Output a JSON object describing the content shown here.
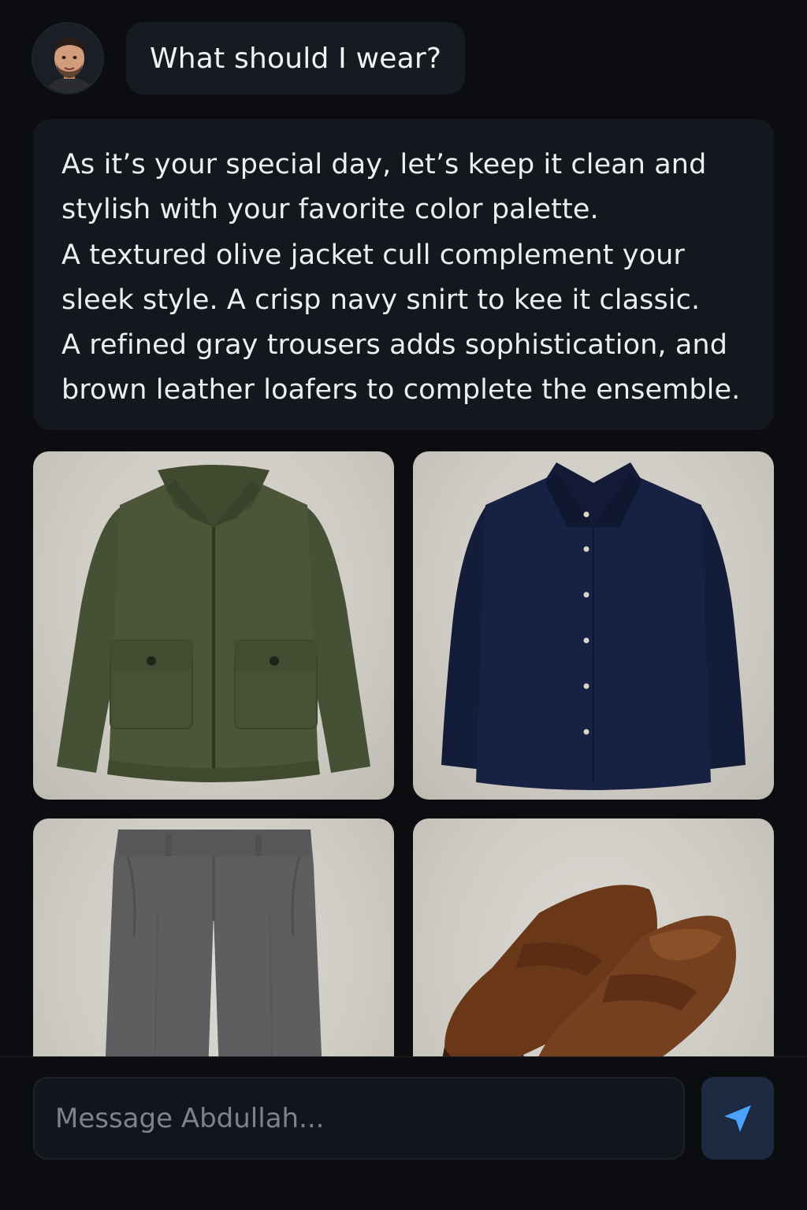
{
  "chat": {
    "user": {
      "avatar_icon": "user-portrait-avatar",
      "message": "What should I wear?"
    },
    "assistant": {
      "lines": [
        "As it’s your special day, let’s keep it clean and",
        "stylish with your favorite color palette.",
        "A textured olive jacket cull complement your",
        "sleek style. A crisp navy snirt to kee it classic.",
        "A refined gray trousers adds sophistication, and",
        "brown leather loafers to complete the ensemble."
      ]
    },
    "outfit_items": [
      {
        "name": "olive-jacket",
        "color": "#4a5236"
      },
      {
        "name": "navy-shirt",
        "color": "#151f3e"
      },
      {
        "name": "gray-trousers",
        "color": "#5e5f61"
      },
      {
        "name": "brown-loafers",
        "color": "#6e3a1d"
      }
    ]
  },
  "composer": {
    "placeholder": "Message Abdullah...",
    "send_icon": "send-arrow-icon",
    "accent": "#4aa3ff"
  }
}
